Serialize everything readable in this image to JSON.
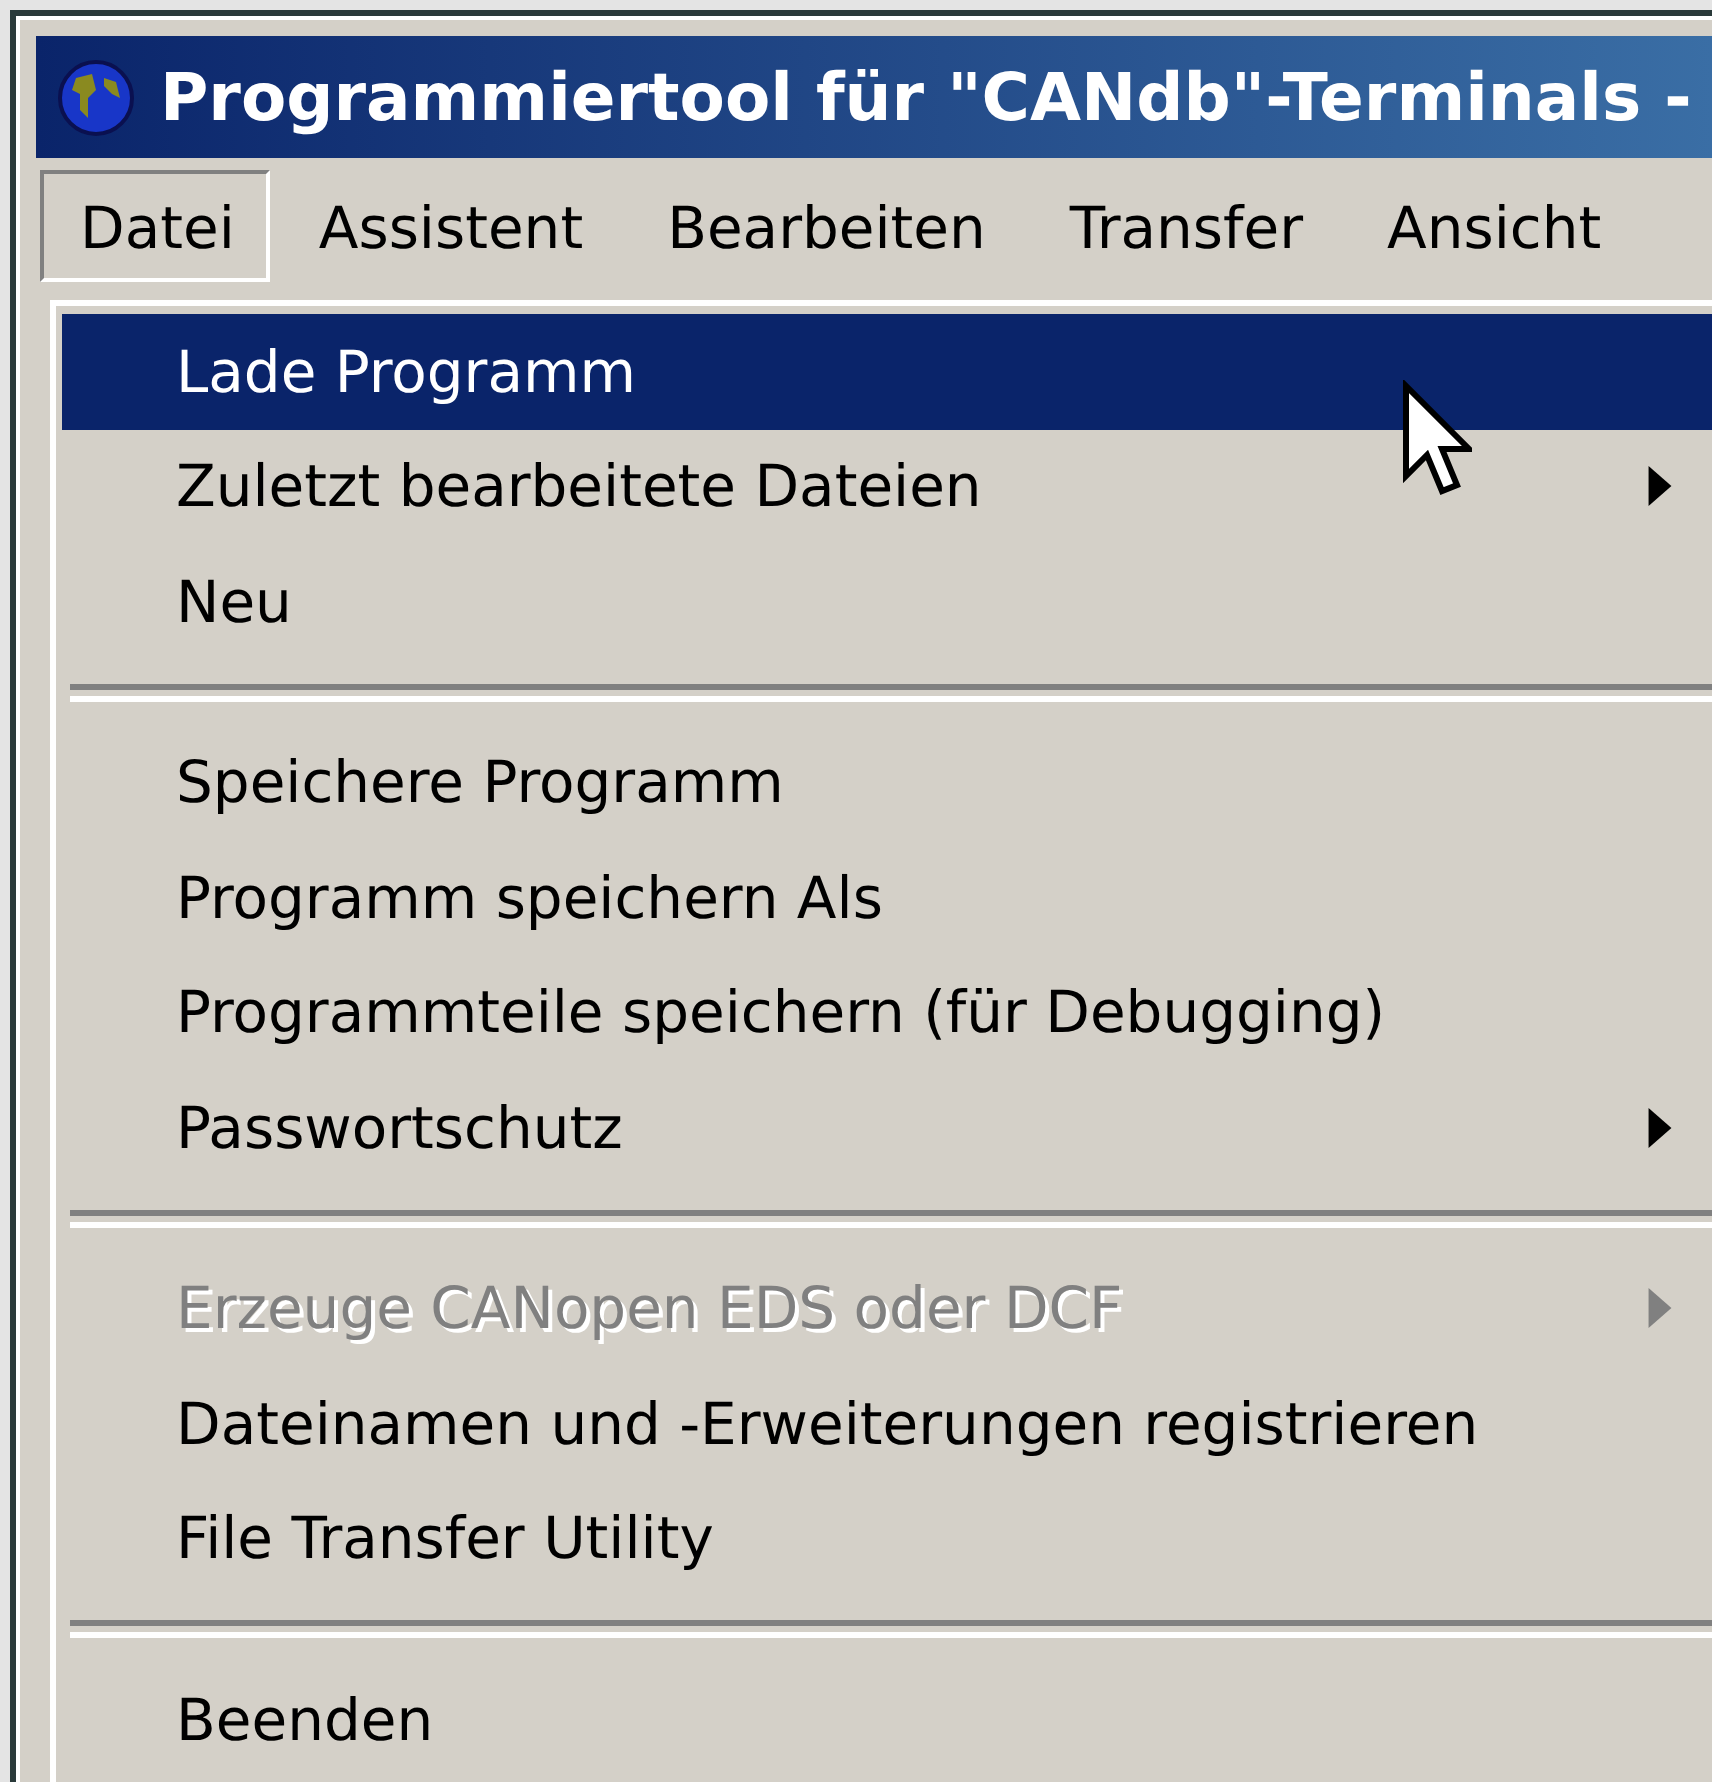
{
  "window": {
    "title": "Programmiertool für \"CANdb\"-Terminals -"
  },
  "menubar": [
    {
      "label": "Datei",
      "selected": true
    },
    {
      "label": "Assistent",
      "selected": false
    },
    {
      "label": "Bearbeiten",
      "selected": false
    },
    {
      "label": "Transfer",
      "selected": false
    },
    {
      "label": "Ansicht",
      "selected": false
    }
  ],
  "menu": {
    "items": [
      {
        "kind": "item",
        "label": "Lade Programm",
        "highlighted": true,
        "disabled": false,
        "submenu": false
      },
      {
        "kind": "item",
        "label": "Zuletzt bearbeitete Dateien",
        "highlighted": false,
        "disabled": false,
        "submenu": true
      },
      {
        "kind": "item",
        "label": "Neu",
        "highlighted": false,
        "disabled": false,
        "submenu": false
      },
      {
        "kind": "separator"
      },
      {
        "kind": "item",
        "label": "Speichere Programm",
        "highlighted": false,
        "disabled": false,
        "submenu": false
      },
      {
        "kind": "item",
        "label": "Programm speichern Als",
        "highlighted": false,
        "disabled": false,
        "submenu": false
      },
      {
        "kind": "item",
        "label": "Programmteile speichern (für Debugging)",
        "highlighted": false,
        "disabled": false,
        "submenu": false
      },
      {
        "kind": "item",
        "label": "Passwortschutz",
        "highlighted": false,
        "disabled": false,
        "submenu": true
      },
      {
        "kind": "separator"
      },
      {
        "kind": "item",
        "label": "Erzeuge CANopen EDS oder DCF",
        "highlighted": false,
        "disabled": true,
        "submenu": true
      },
      {
        "kind": "item",
        "label": "Dateinamen und -Erweiterungen registrieren",
        "highlighted": false,
        "disabled": false,
        "submenu": false
      },
      {
        "kind": "item",
        "label": "File Transfer Utility",
        "highlighted": false,
        "disabled": false,
        "submenu": false
      },
      {
        "kind": "separator"
      },
      {
        "kind": "item",
        "label": "Beenden",
        "highlighted": false,
        "disabled": false,
        "submenu": false
      }
    ]
  }
}
